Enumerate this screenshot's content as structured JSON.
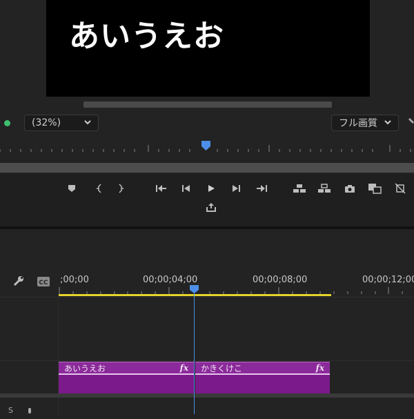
{
  "monitor": {
    "title_overlay": "あいうえお",
    "zoom_level": "(32%)",
    "quality": "フル画質",
    "icons": {
      "zoom_chevron": "chevron-down-icon",
      "quality_chevron": "chevron-down-icon",
      "status": "green-dot",
      "settings": "wrench-icon"
    },
    "transport_controls": [
      "add-marker-icon",
      "mark-in-icon",
      "mark-out-icon",
      "go-to-in-icon",
      "step-back-icon",
      "play-icon",
      "step-forward-icon",
      "go-to-out-icon",
      "lift-icon",
      "extract-icon",
      "export-frame-icon",
      "comparison-view-icon",
      "proxy-toggle-icon",
      "export-icon"
    ]
  },
  "timeline": {
    "timecodes": [
      ";00;00",
      "00;00;04;00",
      "00;00;08;00",
      "00;00;12;00"
    ],
    "clips": [
      {
        "name": "あいうえお",
        "fx": "fx"
      },
      {
        "name": "かきくけこ",
        "fx": "fx"
      }
    ],
    "track_label": "S",
    "colors": {
      "clip": "#7b1a8a",
      "playhead": "#4d8fe8",
      "work_area": "#e6d32b",
      "status_dot": "#3fbf6f"
    }
  }
}
